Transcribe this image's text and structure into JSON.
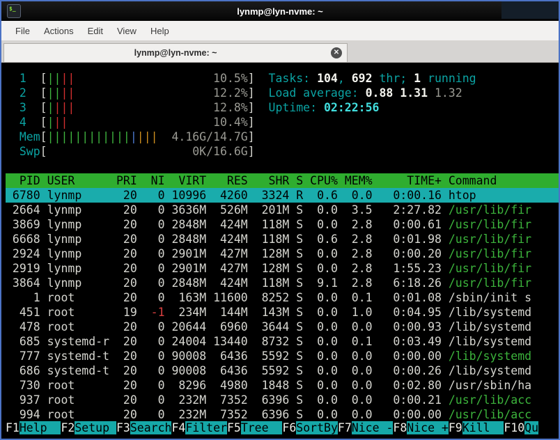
{
  "window": {
    "title": "lynmp@lyn-nvme: ~",
    "icon_text": "$_"
  },
  "menu": {
    "items": [
      "File",
      "Actions",
      "Edit",
      "View",
      "Help"
    ]
  },
  "tab": {
    "title": "lynmp@lyn-nvme: ~",
    "close_glyph": "✕"
  },
  "colors": {
    "window_border": "#4c73c5",
    "label_cyan": "#0ba3a3",
    "bright_cyan": "#41dede",
    "header_green": "#2fad2f",
    "selected_cyan": "#1aacac",
    "thread_green": "#3cb43c",
    "alert_red": "#d84040",
    "bar_green": "#3fb53f",
    "bar_red": "#d22f2f",
    "bar_blue": "#4d7ad0",
    "bar_yellow": "#cf8f1f"
  },
  "htop": {
    "meters": [
      {
        "label": "1  ",
        "bars": [
          {
            "color": "green",
            "count": 2
          },
          {
            "color": "red",
            "count": 2
          }
        ],
        "text": "10.5%"
      },
      {
        "label": "2  ",
        "bars": [
          {
            "color": "green",
            "count": 2
          },
          {
            "color": "red",
            "count": 2
          }
        ],
        "text": "12.2%"
      },
      {
        "label": "3  ",
        "bars": [
          {
            "color": "green",
            "count": 1
          },
          {
            "color": "red",
            "count": 3
          }
        ],
        "text": "12.8%"
      },
      {
        "label": "4  ",
        "bars": [
          {
            "color": "green",
            "count": 1
          },
          {
            "color": "red",
            "count": 2
          }
        ],
        "text": "10.4%"
      },
      {
        "label": "Mem",
        "bars": [
          {
            "color": "green",
            "count": 12
          },
          {
            "color": "blue",
            "count": 1
          },
          {
            "color": "yellow",
            "count": 3
          }
        ],
        "text": "4.16G/14.7G"
      },
      {
        "label": "Swp",
        "bars": [],
        "text": "0K/16.6G"
      }
    ],
    "info": [
      {
        "segments": [
          {
            "style": "cyan",
            "text": "Tasks: "
          },
          {
            "style": "bold",
            "text": "104"
          },
          {
            "style": "cyan",
            "text": ", "
          },
          {
            "style": "bold",
            "text": "692"
          },
          {
            "style": "cyan",
            "text": " thr; "
          },
          {
            "style": "bold",
            "text": "1"
          },
          {
            "style": "cyan",
            "text": " running"
          }
        ]
      },
      {
        "segments": [
          {
            "style": "cyan",
            "text": "Load average: "
          },
          {
            "style": "bold",
            "text": "0.88 "
          },
          {
            "style": "bold",
            "text": "1.31 "
          },
          {
            "style": "dim",
            "text": "1.32"
          }
        ]
      },
      {
        "segments": [
          {
            "style": "cyan",
            "text": "Uptime: "
          },
          {
            "style": "boldcyan",
            "text": "02:22:56"
          }
        ]
      }
    ],
    "columns": [
      {
        "key": "pid",
        "label": "PID",
        "width": 5,
        "align": "right"
      },
      {
        "key": "user",
        "label": "USER",
        "width": 9,
        "align": "left"
      },
      {
        "key": "pri",
        "label": "PRI",
        "width": 3,
        "align": "right"
      },
      {
        "key": "ni",
        "label": "NI",
        "width": 3,
        "align": "right"
      },
      {
        "key": "virt",
        "label": "VIRT",
        "width": 5,
        "align": "right"
      },
      {
        "key": "res",
        "label": "RES",
        "width": 5,
        "align": "right"
      },
      {
        "key": "shr",
        "label": "SHR",
        "width": 5,
        "align": "right"
      },
      {
        "key": "s",
        "label": "S",
        "width": 1,
        "align": "left"
      },
      {
        "key": "cpu",
        "label": "CPU%",
        "width": 4,
        "align": "right"
      },
      {
        "key": "mem",
        "label": "MEM%",
        "width": 4,
        "align": "right"
      },
      {
        "key": "time",
        "label": "TIME+",
        "width": 9,
        "align": "right"
      },
      {
        "key": "command",
        "label": "Command",
        "width": 0,
        "align": "left"
      }
    ],
    "rows": [
      {
        "pid": "6780",
        "user": "lynmp",
        "pri": "20",
        "ni": "0",
        "virt": "10996",
        "res": "4260",
        "shr": "3324",
        "s": "R",
        "cpu": "0.6",
        "mem": "0.0",
        "time": "0:00.16",
        "command": "htop",
        "selected": true
      },
      {
        "pid": "2664",
        "user": "lynmp",
        "pri": "20",
        "ni": "0",
        "virt": "3636M",
        "res": "526M",
        "shr": "201M",
        "s": "S",
        "cpu": "0.0",
        "mem": "3.5",
        "time": "2:27.82",
        "command": "/usr/lib/fir",
        "thread": true
      },
      {
        "pid": "3869",
        "user": "lynmp",
        "pri": "20",
        "ni": "0",
        "virt": "2848M",
        "res": "424M",
        "shr": "118M",
        "s": "S",
        "cpu": "0.0",
        "mem": "2.8",
        "time": "0:00.61",
        "command": "/usr/lib/fir",
        "thread": true
      },
      {
        "pid": "6668",
        "user": "lynmp",
        "pri": "20",
        "ni": "0",
        "virt": "2848M",
        "res": "424M",
        "shr": "118M",
        "s": "S",
        "cpu": "0.6",
        "mem": "2.8",
        "time": "0:01.98",
        "command": "/usr/lib/fir",
        "thread": true
      },
      {
        "pid": "2924",
        "user": "lynmp",
        "pri": "20",
        "ni": "0",
        "virt": "2901M",
        "res": "427M",
        "shr": "128M",
        "s": "S",
        "cpu": "0.0",
        "mem": "2.8",
        "time": "0:00.20",
        "command": "/usr/lib/fir",
        "thread": true
      },
      {
        "pid": "2919",
        "user": "lynmp",
        "pri": "20",
        "ni": "0",
        "virt": "2901M",
        "res": "427M",
        "shr": "128M",
        "s": "S",
        "cpu": "0.0",
        "mem": "2.8",
        "time": "1:55.23",
        "command": "/usr/lib/fir",
        "thread": true
      },
      {
        "pid": "3864",
        "user": "lynmp",
        "pri": "20",
        "ni": "0",
        "virt": "2848M",
        "res": "424M",
        "shr": "118M",
        "s": "S",
        "cpu": "9.1",
        "mem": "2.8",
        "time": "6:18.26",
        "command": "/usr/lib/fir",
        "thread": true
      },
      {
        "pid": "1",
        "user": "root",
        "pri": "20",
        "ni": "0",
        "virt": "163M",
        "res": "11600",
        "shr": "8252",
        "s": "S",
        "cpu": "0.0",
        "mem": "0.1",
        "time": "0:01.08",
        "command": "/sbin/init s"
      },
      {
        "pid": "451",
        "user": "root",
        "pri": "19",
        "ni": "-1",
        "virt": "234M",
        "res": "144M",
        "shr": "143M",
        "s": "S",
        "cpu": "0.0",
        "mem": "1.0",
        "time": "0:04.95",
        "command": "/lib/systemd",
        "ni_alert": true
      },
      {
        "pid": "478",
        "user": "root",
        "pri": "20",
        "ni": "0",
        "virt": "20644",
        "res": "6960",
        "shr": "3644",
        "s": "S",
        "cpu": "0.0",
        "mem": "0.0",
        "time": "0:00.93",
        "command": "/lib/systemd"
      },
      {
        "pid": "685",
        "user": "systemd-r",
        "pri": "20",
        "ni": "0",
        "virt": "24004",
        "res": "13440",
        "shr": "8732",
        "s": "S",
        "cpu": "0.0",
        "mem": "0.1",
        "time": "0:03.49",
        "command": "/lib/systemd"
      },
      {
        "pid": "777",
        "user": "systemd-t",
        "pri": "20",
        "ni": "0",
        "virt": "90008",
        "res": "6436",
        "shr": "5592",
        "s": "S",
        "cpu": "0.0",
        "mem": "0.0",
        "time": "0:00.00",
        "command": "/lib/systemd",
        "thread": true
      },
      {
        "pid": "686",
        "user": "systemd-t",
        "pri": "20",
        "ni": "0",
        "virt": "90008",
        "res": "6436",
        "shr": "5592",
        "s": "S",
        "cpu": "0.0",
        "mem": "0.0",
        "time": "0:00.26",
        "command": "/lib/systemd"
      },
      {
        "pid": "730",
        "user": "root",
        "pri": "20",
        "ni": "0",
        "virt": "8296",
        "res": "4980",
        "shr": "1848",
        "s": "S",
        "cpu": "0.0",
        "mem": "0.0",
        "time": "0:02.80",
        "command": "/usr/sbin/ha"
      },
      {
        "pid": "937",
        "user": "root",
        "pri": "20",
        "ni": "0",
        "virt": "232M",
        "res": "7352",
        "shr": "6396",
        "s": "S",
        "cpu": "0.0",
        "mem": "0.0",
        "time": "0:00.21",
        "command": "/usr/lib/acc",
        "thread": true
      },
      {
        "pid": "994",
        "user": "root",
        "pri": "20",
        "ni": "0",
        "virt": "232M",
        "res": "7352",
        "shr": "6396",
        "s": "S",
        "cpu": "0.0",
        "mem": "0.0",
        "time": "0:00.00",
        "command": "/usr/lib/acc",
        "thread": true
      }
    ],
    "fkeys": [
      {
        "key": "F1",
        "label": "Help  "
      },
      {
        "key": "F2",
        "label": "Setup "
      },
      {
        "key": "F3",
        "label": "Search"
      },
      {
        "key": "F4",
        "label": "Filter"
      },
      {
        "key": "F5",
        "label": "Tree  "
      },
      {
        "key": "F6",
        "label": "SortBy"
      },
      {
        "key": "F7",
        "label": "Nice -"
      },
      {
        "key": "F8",
        "label": "Nice +"
      },
      {
        "key": "F9",
        "label": "Kill  "
      },
      {
        "key": "F10",
        "label": "Qu"
      }
    ]
  }
}
